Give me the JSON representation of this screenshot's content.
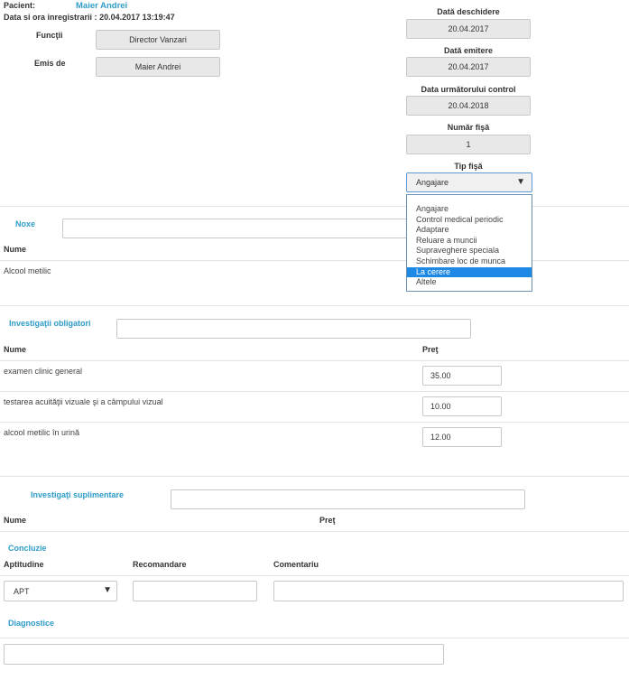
{
  "patient": {
    "label": "Pacient:",
    "name": "Maier Andrei",
    "registration_label": "Data si ora inregistrarii :",
    "registration_value": "20.04.2017 13:19:47"
  },
  "functii": {
    "label": "Funcţii",
    "value": "Director Vanzari"
  },
  "emis_de": {
    "label": "Emis de",
    "value": "Maier Andrei"
  },
  "right": {
    "data_deschidere": {
      "label": "Dată deschidere",
      "value": "20.04.2017"
    },
    "data_emitere": {
      "label": "Dată emitere",
      "value": "20.04.2017"
    },
    "data_control": {
      "label": "Data următorului control",
      "value": "20.04.2018"
    },
    "numar_fisa": {
      "label": "Număr fişă",
      "value": "1"
    },
    "tip_fisa": {
      "label": "Tip fişă",
      "selected": "Angajare",
      "options": [
        "Angajare",
        "Control medical periodic",
        "Adaptare",
        "Reluare a muncii",
        "Supraveghere speciala",
        "Schimbare loc de munca",
        "La cerere",
        "Altele"
      ],
      "highlighted": "La cerere"
    }
  },
  "noxe": {
    "title": "Noxe",
    "col_name": "Nume",
    "rows": [
      {
        "name": "Alcool metilic"
      }
    ]
  },
  "investigatii_obligatorii": {
    "title": "Investigaţii obligatori",
    "col_name": "Nume",
    "col_price": "Preţ",
    "rows": [
      {
        "name": "examen clinic general",
        "price": "35.00"
      },
      {
        "name": "testarea acuităţii vizuale şi a câmpului vizual",
        "price": "10.00"
      },
      {
        "name": "alcool metilic în urină",
        "price": "12.00"
      }
    ]
  },
  "investigatii_suplimentare": {
    "title": "Investigaţi suplimentare",
    "col_name": "Nume",
    "col_price": "Preţ"
  },
  "concluzie": {
    "title": "Concluzie",
    "aptitudine_label": "Aptitudine",
    "aptitudine_value": "APT",
    "recomandare_label": "Recomandare",
    "comentariu_label": "Comentariu"
  },
  "diagnostice": {
    "title": "Diagnostice"
  },
  "colors": {
    "accent": "#2e9cc8",
    "selection": "#1e88e5"
  }
}
